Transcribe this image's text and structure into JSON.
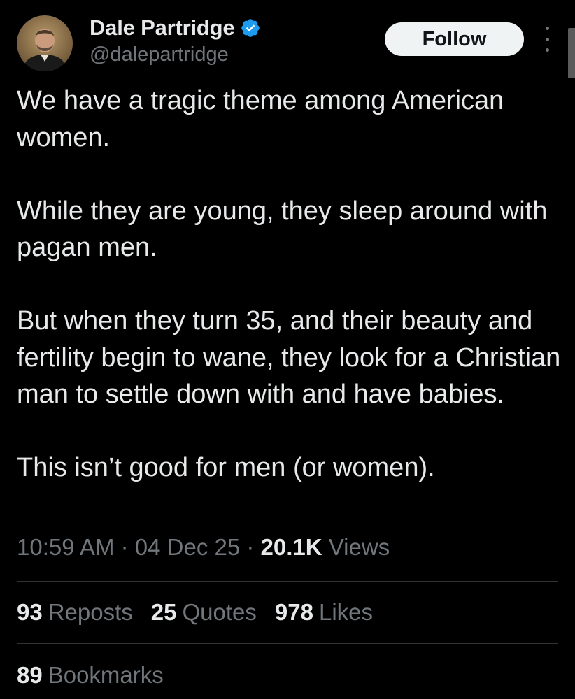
{
  "author": {
    "display_name": "Dale Partridge",
    "handle": "@dalepartridge",
    "verified_icon": "verified-badge-icon",
    "verified_color": "#1d9bf0"
  },
  "header": {
    "follow_label": "Follow",
    "more_icon": "more-vertical-icon"
  },
  "tweet": {
    "paragraphs": [
      "We have a tragic theme among American women.",
      "While they are young, they sleep around with pagan men.",
      "But when they turn 35, and their beauty and fertility begin to wane, they look for a Christian man to settle down with and have babies.",
      "This isn’t good for men (or women)."
    ],
    "time": "10:59 AM",
    "separator": " · ",
    "date": "04 Dec 25",
    "views_count": "20.1K",
    "views_label": "Views"
  },
  "stats": {
    "reposts_count": "93",
    "reposts_label": "Reposts",
    "quotes_count": "25",
    "quotes_label": "Quotes",
    "likes_count": "978",
    "likes_label": "Likes",
    "bookmarks_count": "89",
    "bookmarks_label": "Bookmarks"
  },
  "colors": {
    "background": "#000000",
    "text_primary": "#e7e9ea",
    "text_secondary": "#71767b",
    "divider": "#2f3336",
    "follow_bg": "#eff3f4"
  }
}
